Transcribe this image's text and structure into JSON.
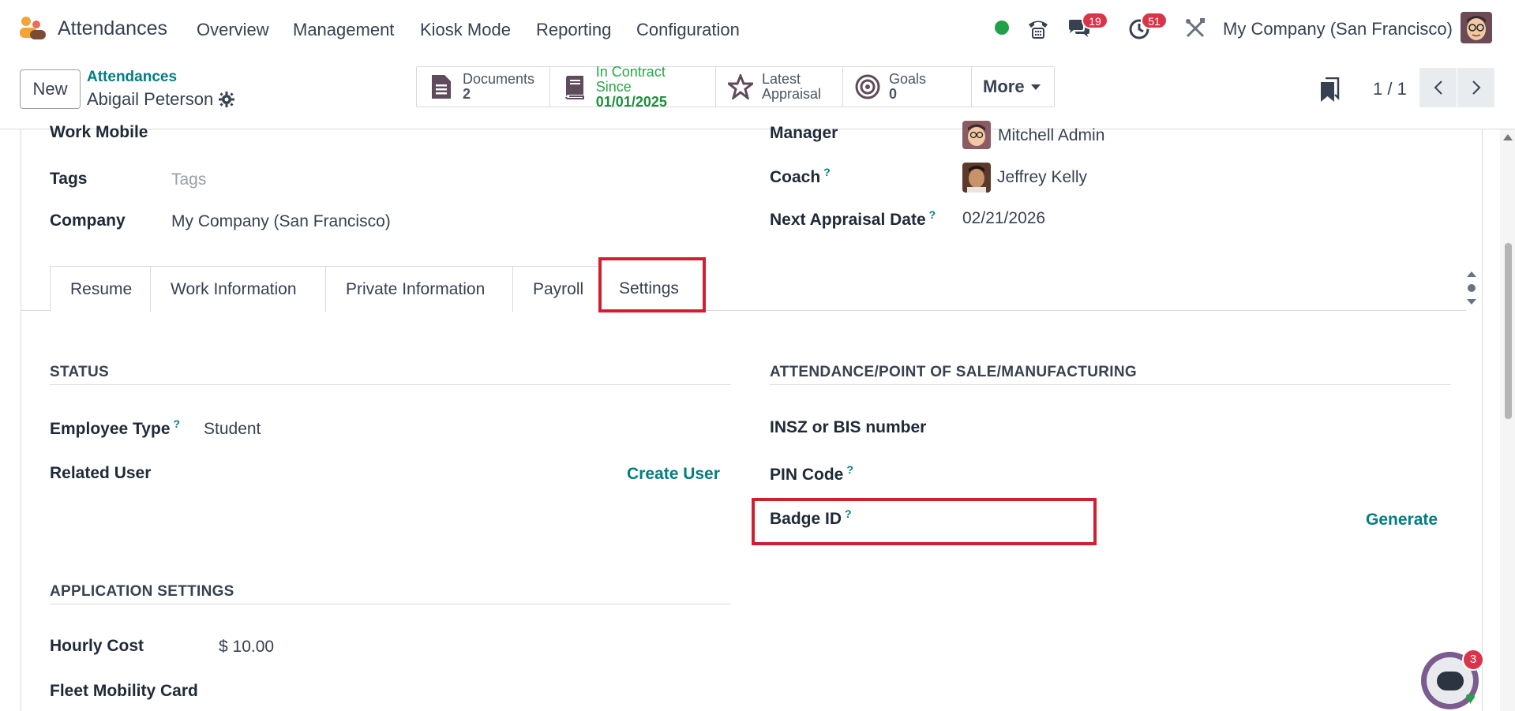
{
  "navbar": {
    "app_name": "Attendances",
    "menus": [
      "Overview",
      "Management",
      "Kiosk Mode",
      "Reporting",
      "Configuration"
    ],
    "messages_count": "19",
    "activities_count": "51",
    "company": "My Company (San Francisco)",
    "status_color": "#21a047"
  },
  "control": {
    "new_label": "New",
    "breadcrumb_parent": "Attendances",
    "breadcrumb_current": "Abigail Peterson",
    "smart_buttons": [
      {
        "label": "Documents",
        "value": "2",
        "icon": "document-icon"
      },
      {
        "label": "In Contract Since",
        "value": "01/01/2025",
        "icon": "book-icon"
      },
      {
        "label": "Latest",
        "value": "Appraisal",
        "icon": "star-icon"
      },
      {
        "label": "Goals",
        "value": "0",
        "icon": "target-icon"
      }
    ],
    "more_label": "More",
    "pager": "1 / 1"
  },
  "form": {
    "work_mobile_label": "Work Mobile",
    "tags_label": "Tags",
    "tags_placeholder": "Tags",
    "company_label": "Company",
    "company_value": "My Company (San Francisco)",
    "manager_label": "Manager",
    "manager_value": "Mitchell Admin",
    "coach_label": "Coach",
    "coach_value": "Jeffrey Kelly",
    "next_appraisal_label": "Next Appraisal Date",
    "next_appraisal_value": "02/21/2026",
    "help_mark": "?"
  },
  "tabs": [
    "Resume",
    "Work Information",
    "Private Information",
    "Payroll",
    "Settings"
  ],
  "settings": {
    "status_title": "STATUS",
    "employee_type_label": "Employee Type",
    "employee_type_value": "Student",
    "related_user_label": "Related User",
    "create_user_label": "Create User",
    "attendance_title": "ATTENDANCE/POINT OF SALE/MANUFACTURING",
    "insz_label": "INSZ or BIS number",
    "pin_label": "PIN Code",
    "badge_label": "Badge ID",
    "generate_label": "Generate",
    "app_settings_title": "APPLICATION SETTINGS",
    "hourly_cost_label": "Hourly Cost",
    "hourly_cost_value": "$ 10.00",
    "fleet_label": "Fleet Mobility Card"
  },
  "chatbot_count": "3",
  "accent_color": "#017e84",
  "highlight_color": "#d0202f"
}
